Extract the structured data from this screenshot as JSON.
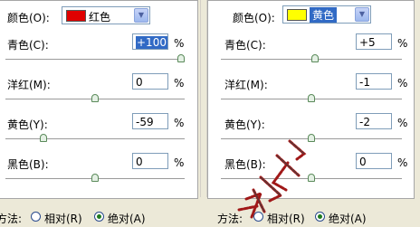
{
  "left_panel": {
    "color_label": "颜色(O):",
    "color_value": "红色",
    "swatch_color": "#e00000",
    "sliders": [
      {
        "label": "青色(C):",
        "value": "+100",
        "pct": "%",
        "position": 1.0
      },
      {
        "label": "洋红(M):",
        "value": "0",
        "pct": "%",
        "position": 0.5
      },
      {
        "label": "黄色(Y):",
        "value": "-59",
        "pct": "%",
        "position": 0.2
      },
      {
        "label": "黑色(B):",
        "value": "0",
        "pct": "%",
        "position": 0.5
      }
    ]
  },
  "right_panel": {
    "color_label": "颜色(O):",
    "color_value": "黄色",
    "swatch_color": "#ffff00",
    "sliders": [
      {
        "label": "青色(C):",
        "value": "+5",
        "pct": "%",
        "position": 0.52
      },
      {
        "label": "洋红(M):",
        "value": "-1",
        "pct": "%",
        "position": 0.5
      },
      {
        "label": "黄色(Y):",
        "value": "-2",
        "pct": "%",
        "position": 0.5
      },
      {
        "label": "黑色(B):",
        "value": "0",
        "pct": "%",
        "position": 0.5
      }
    ]
  },
  "method_left": {
    "label": "方法:",
    "option_relative": "相对(R)",
    "option_absolute": "绝对(A)",
    "selected": "absolute"
  },
  "method_right": {
    "label": "方法:",
    "option_relative": "相对(R)",
    "option_absolute": "绝对(A)",
    "selected": "absolute"
  },
  "colors": {
    "selection": "#316ac5",
    "border": "#7f9db9",
    "thumb": "#5a8a5a",
    "stamp": "#a01818"
  }
}
